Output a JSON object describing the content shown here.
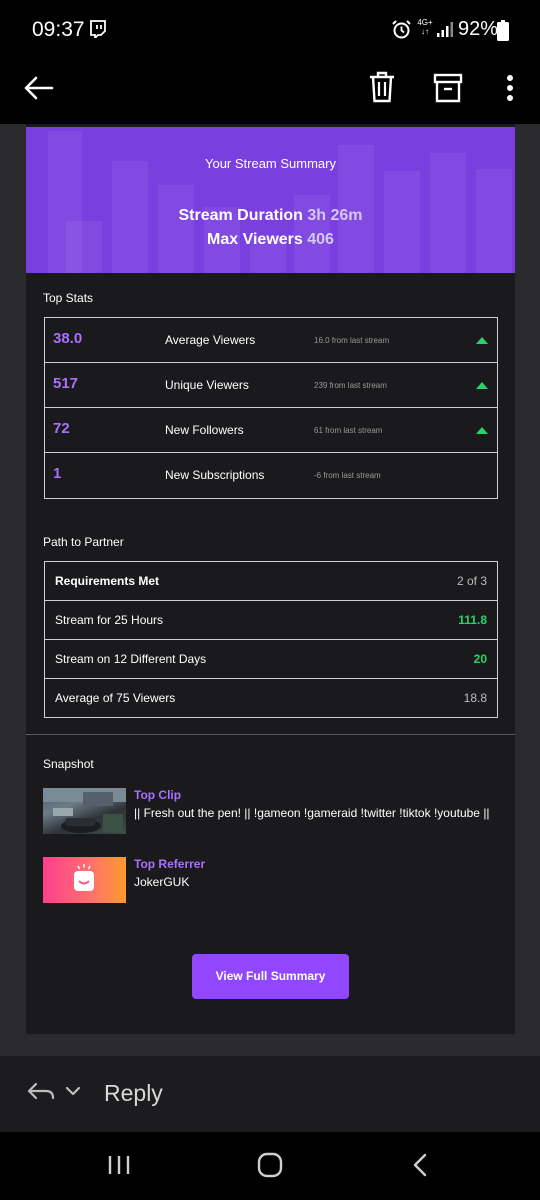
{
  "status_bar": {
    "time": "09:37",
    "network": "4G+",
    "battery": "92%"
  },
  "email": {
    "hero": {
      "title": "Your Stream Summary",
      "duration_label": "Stream Duration",
      "duration_value": "3h 26m",
      "viewers_label": "Max Viewers",
      "viewers_value": "406"
    },
    "top_stats": {
      "title": "Top Stats",
      "rows": [
        {
          "value": "38.0",
          "label": "Average Viewers",
          "delta": "16.0 from last stream",
          "trend": "up"
        },
        {
          "value": "517",
          "label": "Unique Viewers",
          "delta": "239 from last stream",
          "trend": "up"
        },
        {
          "value": "72",
          "label": "New Followers",
          "delta": "61 from last stream",
          "trend": "up"
        },
        {
          "value": "1",
          "label": "New Subscriptions",
          "delta": "-6 from last stream",
          "trend": "none"
        }
      ]
    },
    "partner": {
      "title": "Path to Partner",
      "rows": [
        {
          "label": "Requirements Met",
          "value": "2 of 3"
        },
        {
          "label": "Stream for 25 Hours",
          "value": "111.8"
        },
        {
          "label": "Stream on 12 Different Days",
          "value": "20"
        },
        {
          "label": "Average of 75 Viewers",
          "value": "18.8"
        }
      ]
    },
    "snapshot": {
      "title": "Snapshot",
      "top_clip_heading": "Top Clip",
      "top_clip_text": "|| Fresh out the pen! || !gameon !gameraid !twitter !tiktok !youtube ||",
      "top_referrer_heading": "Top Referrer",
      "top_referrer_text": "JokerGUK"
    },
    "cta_label": "View Full Summary"
  },
  "reply_bar": {
    "label": "Reply"
  },
  "colors": {
    "accent": "#9147ff",
    "hero_bg": "#7b3fe0",
    "stat_value": "#a970ff",
    "positive": "#2bd26b",
    "card_bg": "#1a1a1c"
  },
  "icons": [
    "twitch-icon",
    "alarm-icon",
    "signal-icon",
    "battery-icon",
    "back-arrow-icon",
    "trash-icon",
    "archive-icon",
    "more-vert-icon",
    "reply-icon",
    "chevron-down-icon",
    "recent-apps-icon",
    "home-icon",
    "nav-back-icon"
  ]
}
